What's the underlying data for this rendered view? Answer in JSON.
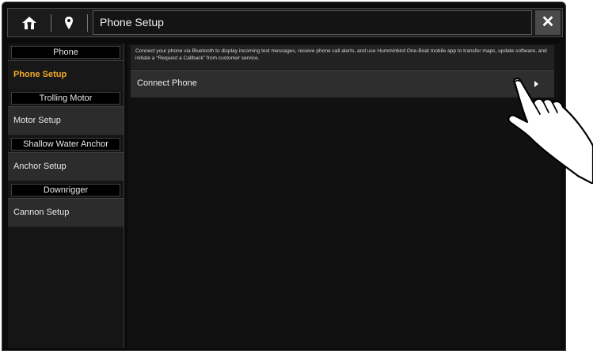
{
  "header": {
    "home_icon": "home-icon",
    "map_icon": "map-pin-icon",
    "title": "Phone Setup",
    "close_icon": "close-icon"
  },
  "sidebar": {
    "sections": [
      {
        "heading": "Phone",
        "items": [
          {
            "label": "Phone Setup",
            "active": true
          }
        ]
      },
      {
        "heading": "Trolling Motor",
        "items": [
          {
            "label": "Motor Setup",
            "active": false
          }
        ]
      },
      {
        "heading": "Shallow Water Anchor",
        "items": [
          {
            "label": "Anchor Setup",
            "active": false
          }
        ]
      },
      {
        "heading": "Downrigger",
        "items": [
          {
            "label": "Cannon Setup",
            "active": false
          }
        ]
      }
    ]
  },
  "main": {
    "description": "Connect your phone via Bluetooth to display incoming text messages, receive phone call alerts, and use Humminbird One-Boat mobile app to transfer maps, update software, and initiate a “Request a Callback” from customer service.",
    "rows": [
      {
        "label": "Connect Phone",
        "icon": "chevron-right-icon"
      }
    ]
  },
  "colors": {
    "accent": "#f0a828",
    "background": "#0b0b0b",
    "panel": "#2e2e2e"
  }
}
